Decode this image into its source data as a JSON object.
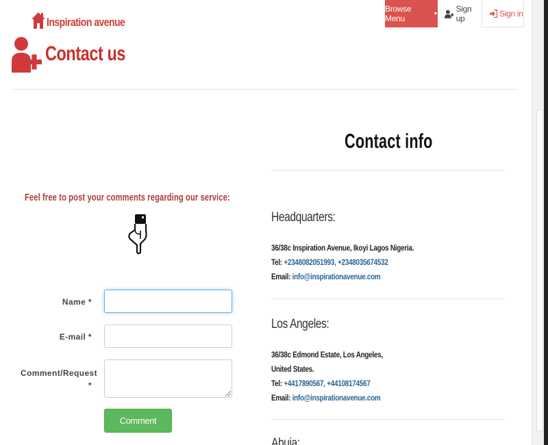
{
  "brand": {
    "name": "Inspiration avenue",
    "icon": "house-icon"
  },
  "nav": {
    "browse_label": "Browse Menu",
    "signup_label": "Sign up",
    "signin_label": "Sign in"
  },
  "page": {
    "title": "Contact us",
    "icon": "add-user-icon"
  },
  "form": {
    "prompt": "Feel free to post your comments regarding our service:",
    "name_label": "Name *",
    "email_label": "E-mail *",
    "comment_label_line1": "Comment/Request",
    "comment_label_line2": "*",
    "name_value": "",
    "email_value": "",
    "comment_value": "",
    "submit_label": "Comment"
  },
  "contact": {
    "title": "Contact info",
    "offices": [
      {
        "name": "Headquarters:",
        "address_lines": [
          "36/38c Inspiration Avenue, Ikoyi Lagos Nigeria."
        ],
        "tel_label": "Tel:",
        "phones": "+2348082051993, +2348035674532",
        "email_label": "Email:",
        "email": "info@inspirationavenue.com"
      },
      {
        "name": "Los Angeles:",
        "address_lines": [
          "36/38c Edmond Estate, Los Angeles,",
          "United States."
        ],
        "tel_label": "Tel:",
        "phones": "+4417890567, +44108174567",
        "email_label": "Email:",
        "email": "info@inspirationavenue.com"
      },
      {
        "name": "Abuja:"
      }
    ]
  },
  "colors": {
    "brand_red": "#d03a3a",
    "nav_red": "#d9534f",
    "button_green": "#5cb85c",
    "link_blue": "#2a6496"
  }
}
